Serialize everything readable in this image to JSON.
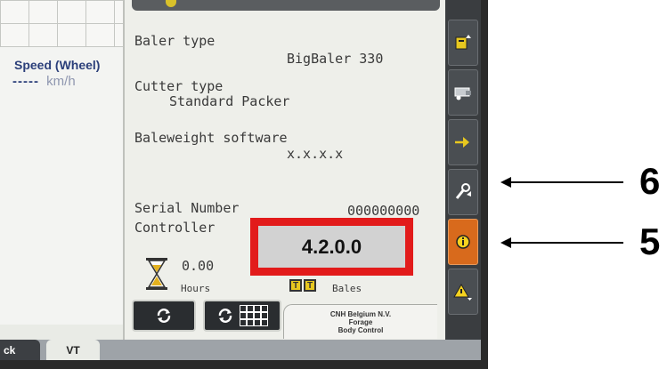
{
  "left_panel": {
    "speed_label": "Speed (Wheel)",
    "speed_value": "-----",
    "speed_unit": "km/h"
  },
  "info": {
    "baler_type_label": "Baler type",
    "baler_type_value": "BigBaler 330",
    "cutter_type_label": "Cutter type",
    "cutter_type_value": "Standard Packer",
    "baleweight_label": "Baleweight software",
    "baleweight_value": "x.x.x.x",
    "serial_label": "Serial Number",
    "serial_value": "000000000",
    "controller_label": "Controller",
    "controller_value": "4.2.0.0"
  },
  "counters": {
    "hours_value": "0.00",
    "hours_label": "Hours",
    "bale_icon_text": "T",
    "bales_label": "Bales"
  },
  "footer": {
    "company": "CNH Belgium N.V.",
    "line2": "Forage",
    "line3": "Body Control"
  },
  "softkeys": [
    {
      "icon": "page-up-icon"
    },
    {
      "icon": "baler-icon"
    },
    {
      "icon": "settings-arrow-icon"
    },
    {
      "icon": "tools-icon"
    },
    {
      "icon": "info-icon",
      "active": true
    },
    {
      "icon": "warning-icon"
    }
  ],
  "tabs": {
    "back_label": "ck",
    "vt_label": "VT"
  },
  "annotations": {
    "label_6": "6",
    "label_5": "5"
  },
  "colors": {
    "highlight": "#e21b1b",
    "active_softkey": "#d86a1c",
    "speed_text": "#2b3f7a"
  }
}
